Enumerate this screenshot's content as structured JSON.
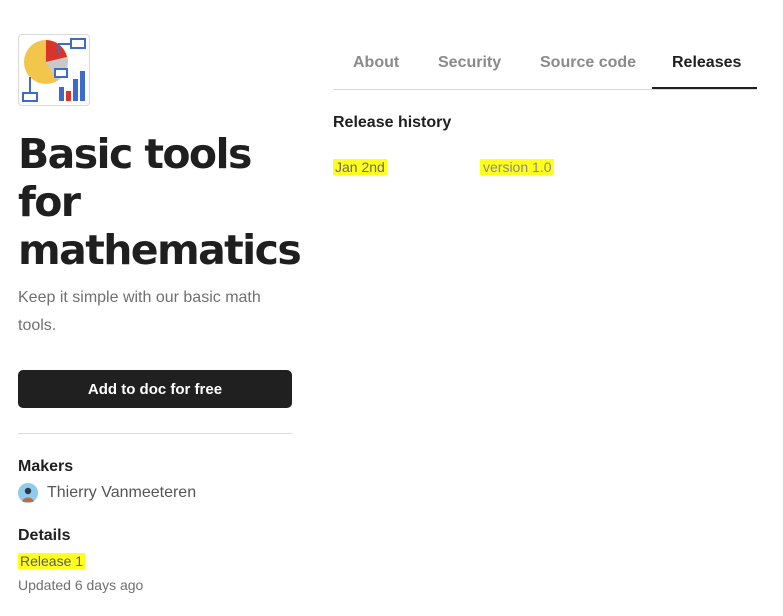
{
  "app": {
    "title": "Basic tools for mathematics",
    "subtitle": "Keep it simple with our basic math tools.",
    "cta_label": "Add to doc for free"
  },
  "makers": {
    "title": "Makers",
    "items": [
      {
        "name": "Thierry Vanmeeteren"
      }
    ]
  },
  "details": {
    "title": "Details",
    "release": "Release 1",
    "updated": "Updated 6 days ago"
  },
  "tabs": [
    {
      "label": "About",
      "active": false
    },
    {
      "label": "Security",
      "active": false
    },
    {
      "label": "Source code",
      "active": false
    },
    {
      "label": "Releases",
      "active": true
    }
  ],
  "releases": {
    "heading": "Release history",
    "rows": [
      {
        "date": "Jan 2nd",
        "version": "version 1.0"
      }
    ]
  },
  "colors": {
    "highlight": "#ffff1c",
    "button_bg": "#202020",
    "text": "#1f1f1f",
    "muted": "#707070"
  },
  "icons": {
    "app_icon": "math-chart-icon",
    "avatar": "person-avatar-icon"
  }
}
